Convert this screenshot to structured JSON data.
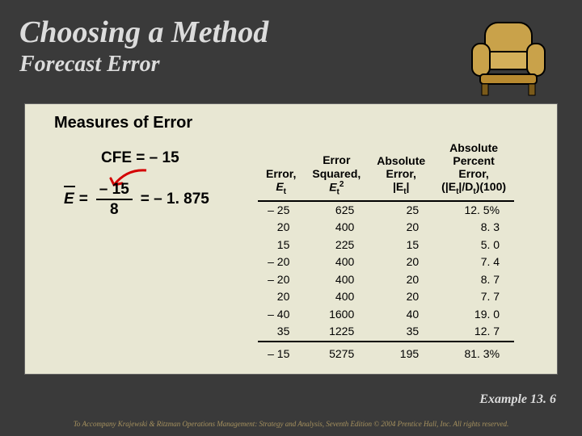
{
  "title": "Choosing a Method",
  "subtitle": "Forecast Error",
  "panel": {
    "measures_heading": "Measures of Error",
    "cfe_line": "CFE = – 15",
    "ebar": {
      "lhs": "E =",
      "num": "– 15",
      "den": "8",
      "rhs": "= – 1. 875"
    }
  },
  "table": {
    "headers": {
      "c1a": "Error,",
      "c1b": "E",
      "c2a": "Error",
      "c2b": "Squared,",
      "c2c": "E",
      "c3a": "Absolute",
      "c3b": "Error,",
      "c3c": "|E",
      "c3d": "|",
      "c4a": "Absolute",
      "c4b": "Percent",
      "c4c": "Error,",
      "c4d": "(|E",
      "c4e": "|/D",
      "c4f": ")(100)"
    },
    "rows": [
      {
        "e": "– 25",
        "sq": "625",
        "abs": "25",
        "ape": "12. 5%"
      },
      {
        "e": "20",
        "sq": "400",
        "abs": "20",
        "ape": "8. 3"
      },
      {
        "e": "15",
        "sq": "225",
        "abs": "15",
        "ape": "5. 0"
      },
      {
        "e": "– 20",
        "sq": "400",
        "abs": "20",
        "ape": "7. 4"
      },
      {
        "e": "– 20",
        "sq": "400",
        "abs": "20",
        "ape": "8. 7"
      },
      {
        "e": "20",
        "sq": "400",
        "abs": "20",
        "ape": "7. 7"
      },
      {
        "e": "– 40",
        "sq": "1600",
        "abs": "40",
        "ape": "19. 0"
      },
      {
        "e": "35",
        "sq": "1225",
        "abs": "35",
        "ape": "12. 7"
      }
    ],
    "totals": {
      "e": "– 15",
      "sq": "5275",
      "abs": "195",
      "ape": "81. 3%"
    }
  },
  "example_label": "Example 13. 6",
  "footer": "To Accompany Krajewski & Ritzman Operations Management: Strategy and Analysis, Seventh Edition © 2004 Prentice Hall, Inc. All rights reserved.",
  "t_sub": "t",
  "two_sup": "2",
  "chart_data": {
    "type": "table",
    "title": "Measures of Error",
    "columns": [
      "Error E_t",
      "Error Squared E_t^2",
      "Absolute Error |E_t|",
      "Absolute Percent Error (|E_t|/D_t)(100)"
    ],
    "rows": [
      [
        -25,
        625,
        25,
        12.5
      ],
      [
        20,
        400,
        20,
        8.3
      ],
      [
        15,
        225,
        15,
        5.0
      ],
      [
        -20,
        400,
        20,
        7.4
      ],
      [
        -20,
        400,
        20,
        8.7
      ],
      [
        20,
        400,
        20,
        7.7
      ],
      [
        -40,
        1600,
        40,
        19.0
      ],
      [
        35,
        1225,
        35,
        12.7
      ]
    ],
    "totals": [
      -15,
      5275,
      195,
      81.3
    ],
    "derived": {
      "CFE": -15,
      "E_bar": -1.875
    }
  }
}
